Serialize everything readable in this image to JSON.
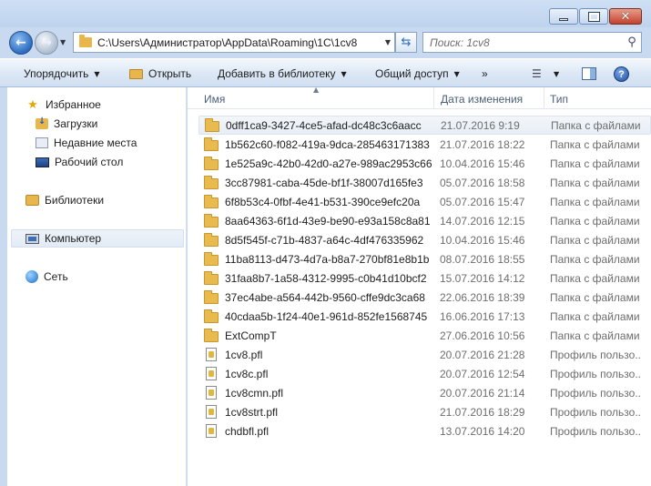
{
  "address": {
    "path": "C:\\Users\\Администратор\\AppData\\Roaming\\1C\\1cv8"
  },
  "search": {
    "placeholder": "Поиск: 1cv8"
  },
  "toolbar": {
    "organize": "Упорядочить",
    "open": "Открыть",
    "add_to_library": "Добавить в библиотеку",
    "share": "Общий доступ",
    "more": "»"
  },
  "nav": {
    "favorites": "Избранное",
    "downloads": "Загрузки",
    "recent": "Недавние места",
    "desktop": "Рабочий стол",
    "libraries": "Библиотеки",
    "computer": "Компьютер",
    "network": "Сеть"
  },
  "columns": {
    "name": "Имя",
    "date": "Дата изменения",
    "type": "Тип"
  },
  "files": [
    {
      "name": "0dff1ca9-3427-4ce5-afad-dc48c3c6aacc",
      "date": "21.07.2016 9:19",
      "type": "Папка с файлами",
      "kind": "folder"
    },
    {
      "name": "1b562c60-f082-419a-9dca-285463171383",
      "date": "21.07.2016 18:22",
      "type": "Папка с файлами",
      "kind": "folder"
    },
    {
      "name": "1e525a9c-42b0-42d0-a27e-989ac2953c66",
      "date": "10.04.2016 15:46",
      "type": "Папка с файлами",
      "kind": "folder"
    },
    {
      "name": "3cc87981-caba-45de-bf1f-38007d165fe3",
      "date": "05.07.2016 18:58",
      "type": "Папка с файлами",
      "kind": "folder"
    },
    {
      "name": "6f8b53c4-0fbf-4e41-b531-390ce9efc20a",
      "date": "05.07.2016 15:47",
      "type": "Папка с файлами",
      "kind": "folder"
    },
    {
      "name": "8aa64363-6f1d-43e9-be90-e93a158c8a81",
      "date": "14.07.2016 12:15",
      "type": "Папка с файлами",
      "kind": "folder"
    },
    {
      "name": "8d5f545f-c71b-4837-a64c-4df476335962",
      "date": "10.04.2016 15:46",
      "type": "Папка с файлами",
      "kind": "folder"
    },
    {
      "name": "11ba8113-d473-4d7a-b8a7-270bf81e8b1b",
      "date": "08.07.2016 18:55",
      "type": "Папка с файлами",
      "kind": "folder"
    },
    {
      "name": "31faa8b7-1a58-4312-9995-c0b41d10bcf2",
      "date": "15.07.2016 14:12",
      "type": "Папка с файлами",
      "kind": "folder"
    },
    {
      "name": "37ec4abe-a564-442b-9560-cffe9dc3ca68",
      "date": "22.06.2016 18:39",
      "type": "Папка с файлами",
      "kind": "folder"
    },
    {
      "name": "40cdaa5b-1f24-40e1-961d-852fe1568745",
      "date": "16.06.2016 17:13",
      "type": "Папка с файлами",
      "kind": "folder"
    },
    {
      "name": "ExtCompT",
      "date": "27.06.2016 10:56",
      "type": "Папка с файлами",
      "kind": "folder"
    },
    {
      "name": "1cv8.pfl",
      "date": "20.07.2016 21:28",
      "type": "Профиль пользо...",
      "kind": "pfl"
    },
    {
      "name": "1cv8c.pfl",
      "date": "20.07.2016 12:54",
      "type": "Профиль пользо...",
      "kind": "pfl"
    },
    {
      "name": "1cv8cmn.pfl",
      "date": "20.07.2016 21:14",
      "type": "Профиль пользо...",
      "kind": "pfl"
    },
    {
      "name": "1cv8strt.pfl",
      "date": "21.07.2016 18:29",
      "type": "Профиль пользо...",
      "kind": "pfl"
    },
    {
      "name": "chdbfl.pfl",
      "date": "13.07.2016 14:20",
      "type": "Профиль пользо...",
      "kind": "pfl"
    }
  ],
  "icons": {
    "back": "back-arrow-icon",
    "forward": "forward-arrow-icon",
    "refresh": "refresh-icon",
    "search": "search-icon",
    "help": "help-icon"
  },
  "colors": {
    "chrome": "#c9daf0",
    "folder": "#e9bb4f",
    "header_text": "#4c607a",
    "secondary_text": "#6d6d6d"
  }
}
